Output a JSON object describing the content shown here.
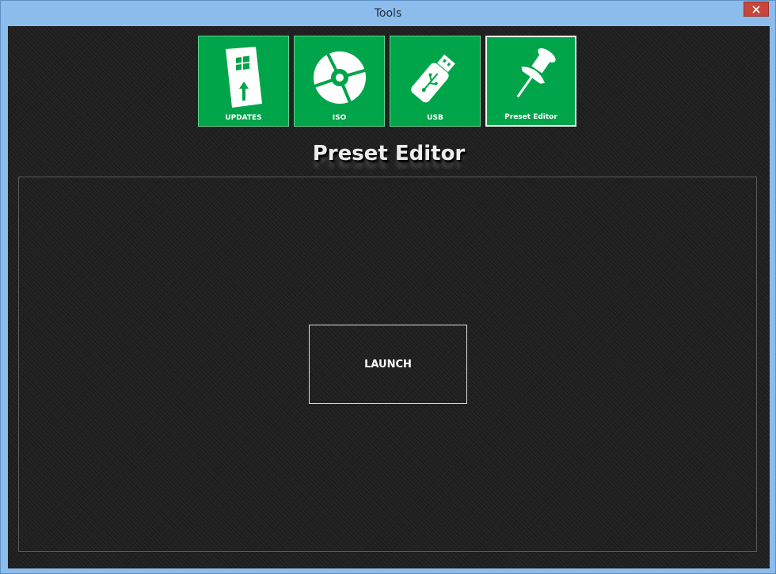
{
  "window": {
    "title": "Tools"
  },
  "tiles": [
    {
      "label": "UPDATES",
      "icon": "windows-update-icon",
      "selected": false
    },
    {
      "label": "ISO",
      "icon": "disc-icon",
      "selected": false
    },
    {
      "label": "USB",
      "icon": "usb-drive-icon",
      "selected": false
    },
    {
      "label": "Preset Editor",
      "icon": "pushpin-icon",
      "selected": true
    }
  ],
  "section": {
    "title": "Preset Editor"
  },
  "panel": {
    "launch_label": "LAUNCH"
  },
  "colors": {
    "tile_green": "#00a54a",
    "background": "#202020",
    "titlebar": "#8cbcec",
    "close_red": "#c7473c"
  }
}
